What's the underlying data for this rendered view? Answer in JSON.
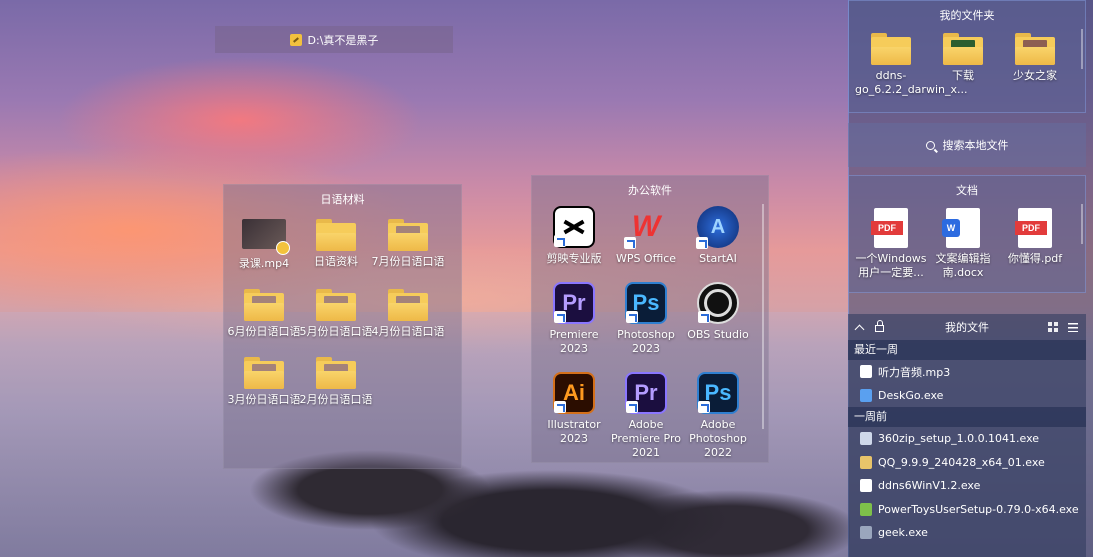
{
  "path_bar": {
    "text": "D:\\真不是黑子"
  },
  "fence_japanese": {
    "title": "日语材料",
    "items": [
      "录课.mp4",
      "日语资料",
      "7月份日语口语",
      "6月份日语口语",
      "5月份日语口语",
      "4月份日语口语",
      "3月份日语口语",
      "2月份日语口语"
    ]
  },
  "fence_office": {
    "title": "办公软件",
    "items": [
      "剪映专业版",
      "WPS Office",
      "StartAI",
      "Premiere 2023",
      "Photoshop 2023",
      "OBS Studio",
      "Illustrator 2023",
      "Adobe Premiere Pro 2021",
      "Adobe Photoshop 2022"
    ],
    "icon_text": {
      "pr": "Pr",
      "ps": "Ps",
      "ai": "Ai"
    }
  },
  "my_folders": {
    "title": "我的文件夹",
    "items": [
      "ddns-go_6.2.2_darwin_x...",
      "下载",
      "少女之家"
    ]
  },
  "search": {
    "placeholder": "搜索本地文件"
  },
  "documents": {
    "title": "文档",
    "items": [
      "一个Windows用户一定要...",
      "文案编辑指南.docx",
      "你懂得.pdf"
    ],
    "badges": {
      "pdf": "PDF",
      "word": "W"
    }
  },
  "my_files": {
    "title": "我的文件",
    "group_recent": "最近一周",
    "recent": [
      "听力音频.mp3",
      "DeskGo.exe"
    ],
    "group_week_ago": "一周前",
    "week_ago": [
      "360zip_setup_1.0.0.1041.exe",
      "QQ_9.9.9_240428_x64_01.exe",
      "ddns6WinV1.2.exe",
      "PowerToysUserSetup-0.79.0-x64.exe",
      "geek.exe"
    ]
  }
}
